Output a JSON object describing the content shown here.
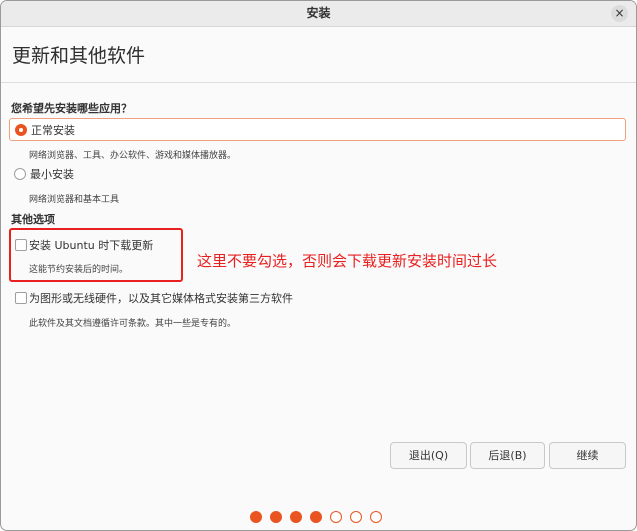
{
  "window": {
    "title": "安装",
    "close_glyph": "×"
  },
  "page": {
    "title": "更新和其他软件"
  },
  "install_type": {
    "question": "您希望先安装哪些应用？",
    "options": [
      {
        "label": "正常安装",
        "description": "网络浏览器、工具、办公软件、游戏和媒体播放器。",
        "selected": true
      },
      {
        "label": "最小安装",
        "description": "网络浏览器和基本工具",
        "selected": false
      }
    ]
  },
  "other_options": {
    "title": "其他选项",
    "items": [
      {
        "label": "安装 Ubuntu 时下载更新",
        "description": "这能节约安装后的时间。",
        "checked": false
      },
      {
        "label": "为图形或无线硬件，以及其它媒体格式安装第三方软件",
        "description": "此软件及其文档遵循许可条款。其中一些是专有的。",
        "checked": false
      }
    ]
  },
  "annotation": {
    "text": "这里不要勾选，否则会下载更新安装时间过长",
    "color": "#e8201f"
  },
  "buttons": {
    "quit": "退出(Q)",
    "back": "后退(B)",
    "continue": "继续"
  },
  "progress": {
    "total_steps": 7,
    "completed_steps": 4
  },
  "colors": {
    "accent": "#e95420"
  }
}
